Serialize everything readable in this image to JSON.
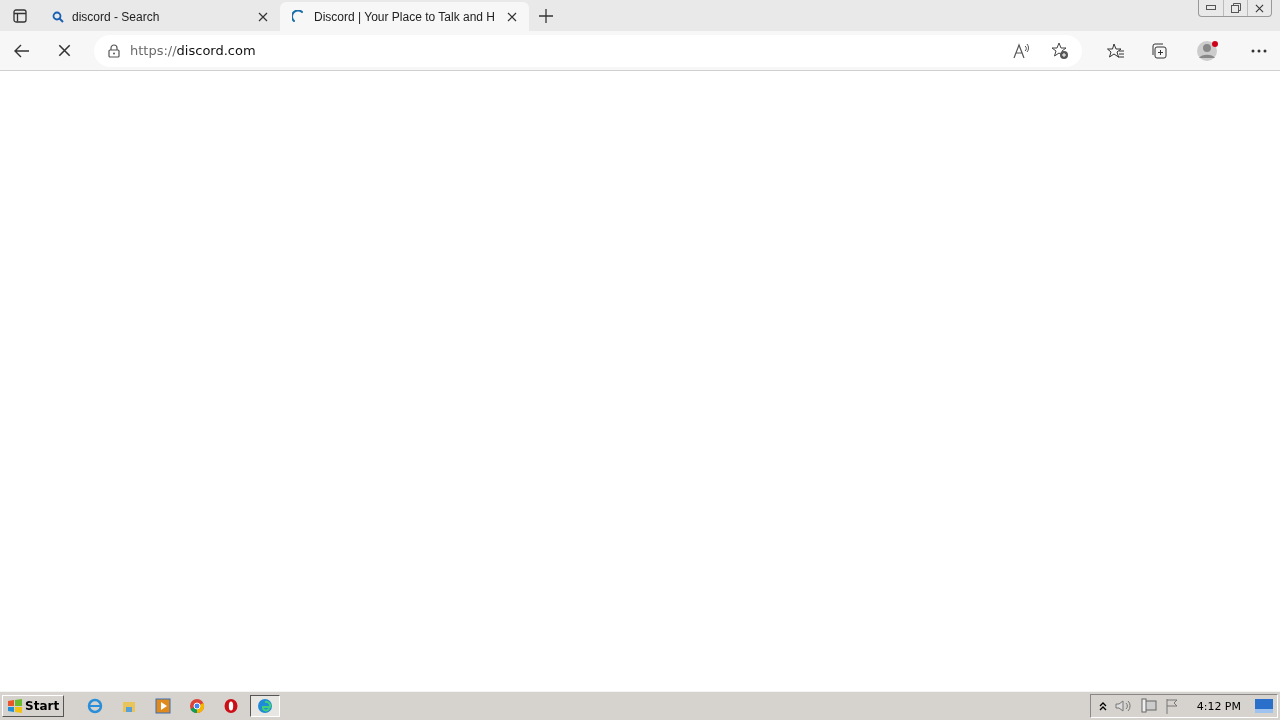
{
  "tabs": [
    {
      "title": "discord - Search",
      "kind": "search",
      "selected": false
    },
    {
      "title": "Discord | Your Place to Talk and H",
      "kind": "loading",
      "selected": true
    }
  ],
  "address": {
    "scheme": "https://",
    "host": "discord.com"
  },
  "page_loading": true,
  "taskbar": {
    "start": "Start",
    "apps": [
      {
        "kind": "ie",
        "selected": false
      },
      {
        "kind": "folder",
        "selected": false
      },
      {
        "kind": "media",
        "selected": false
      },
      {
        "kind": "chrome",
        "selected": false
      },
      {
        "kind": "opera",
        "selected": false
      },
      {
        "kind": "edge",
        "selected": true
      }
    ],
    "time": "4:12 PM"
  }
}
